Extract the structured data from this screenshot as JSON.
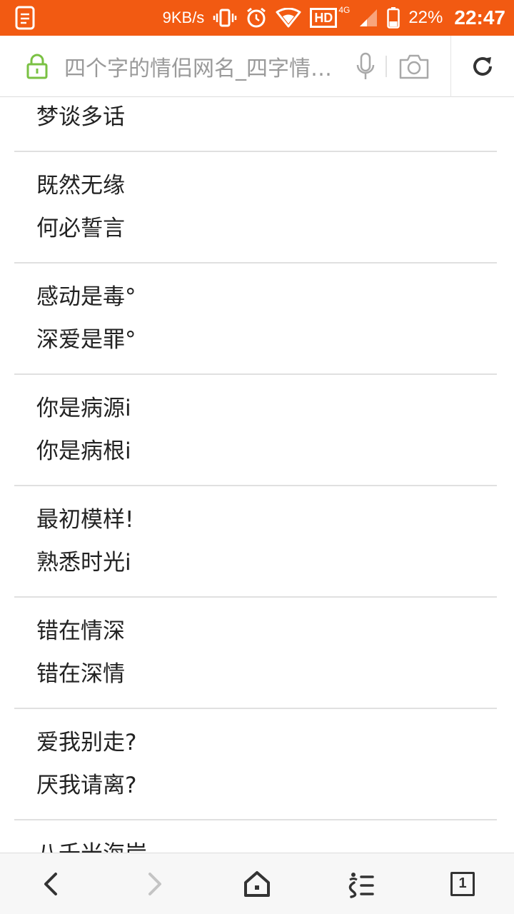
{
  "status_bar": {
    "net_speed": "9KB/s",
    "hd_label": "HD",
    "network_type": "4G",
    "battery": "22%",
    "time": "22:47"
  },
  "address_bar": {
    "url_text": "四个字的情侣网名_四字情…"
  },
  "entries": [
    [
      "梦谈多话"
    ],
    [
      "既然无缘",
      "何必誓言"
    ],
    [
      "感动是毒°",
      "深爱是罪°"
    ],
    [
      "你是病源i",
      "你是病根i"
    ],
    [
      "最初模样!",
      "熟悉时光i"
    ],
    [
      "错在情深",
      "错在深情"
    ],
    [
      "爱我别走?",
      "厌我请离?"
    ],
    [
      "八千米海岸."
    ]
  ],
  "bottom_nav": {
    "tab_count": "1"
  },
  "colors": {
    "status_bar": "#f25a12",
    "lock_green": "#7ac143"
  }
}
